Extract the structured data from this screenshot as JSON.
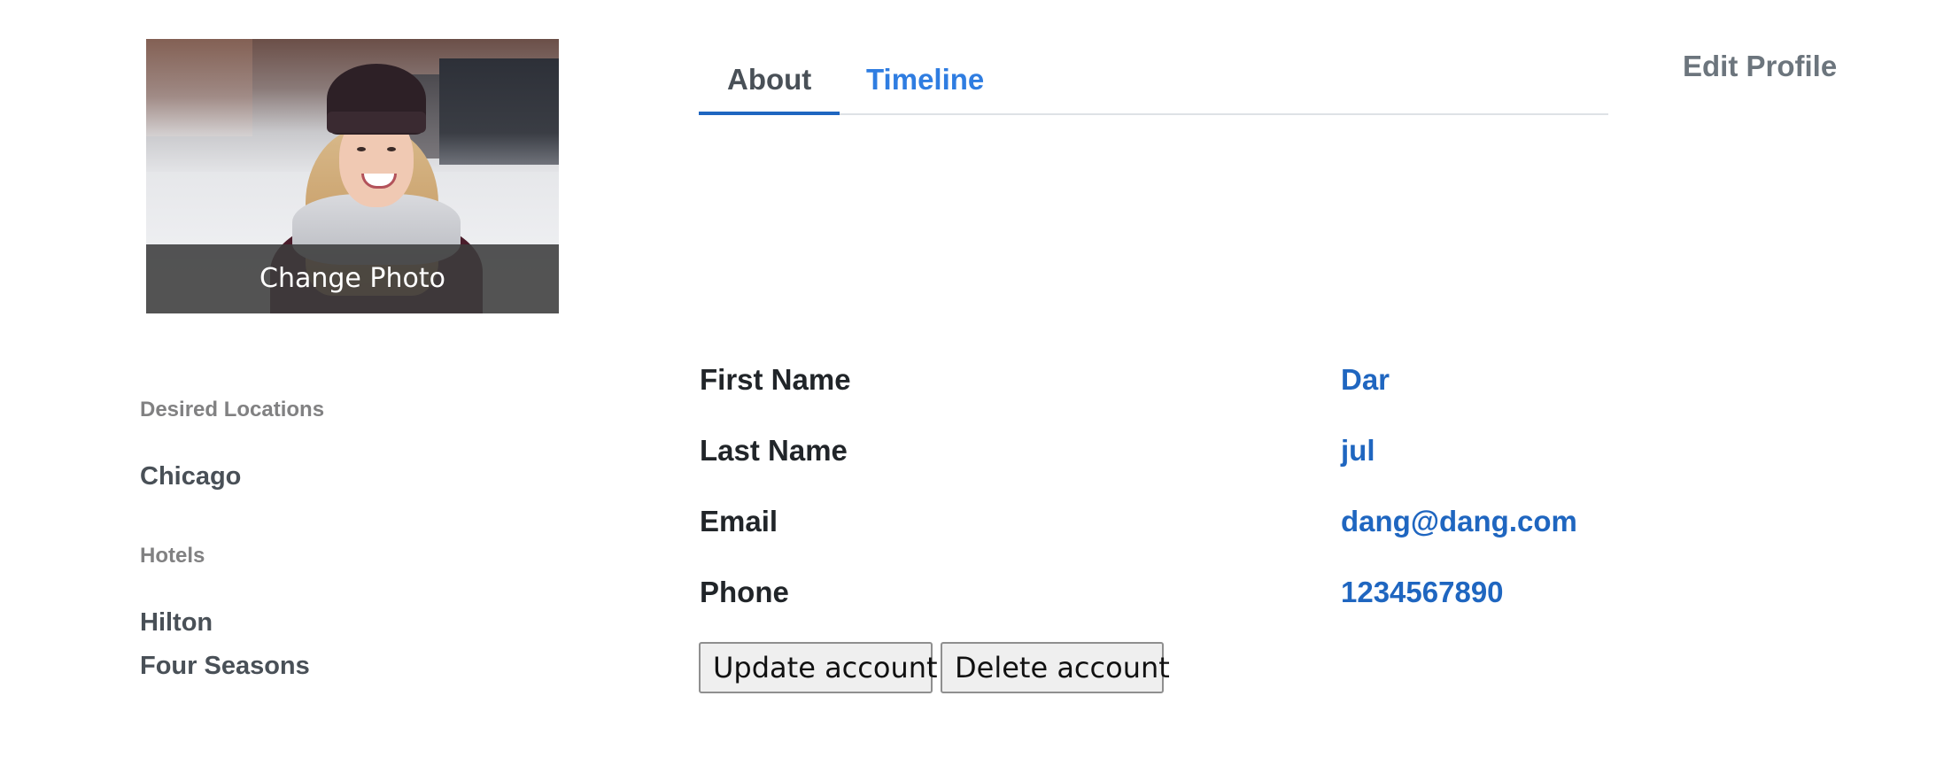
{
  "profile": {
    "photo_alt": "Profile photo",
    "change_photo_label": "Change Photo"
  },
  "tabs": [
    {
      "label": "About",
      "active": true
    },
    {
      "label": "Timeline",
      "active": false
    }
  ],
  "edit_profile_label": "Edit Profile",
  "sidebar": {
    "desired_locations_heading": "Desired Locations",
    "desired_locations": [
      "Chicago"
    ],
    "hotels_heading": "Hotels",
    "hotels": [
      "Hilton",
      "Four Seasons"
    ]
  },
  "details": [
    {
      "label": "First Name",
      "value": "Dar"
    },
    {
      "label": "Last Name",
      "value": "jul"
    },
    {
      "label": "Email",
      "value": "dang@dang.com"
    },
    {
      "label": "Phone",
      "value": "1234567890"
    }
  ],
  "actions": {
    "update_label": "Update account",
    "delete_label": "Delete account"
  },
  "colors": {
    "accent": "#1f66c0",
    "tab_inactive": "#2f7de1",
    "muted": "#6c757d"
  }
}
